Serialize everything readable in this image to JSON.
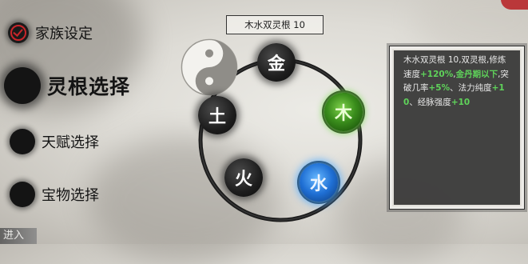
{
  "menu": {
    "items": [
      {
        "label": "家族设定",
        "state": "done"
      },
      {
        "label": "灵根选择",
        "state": "active"
      },
      {
        "label": "天赋选择",
        "state": "pending"
      },
      {
        "label": "宝物选择",
        "state": "pending"
      }
    ],
    "edge_text": "进入"
  },
  "header": {
    "title": "木水双灵根 10"
  },
  "wheel": {
    "elements": [
      {
        "label": "金",
        "selected": false
      },
      {
        "label": "木",
        "selected": true,
        "color": "#4caf2a"
      },
      {
        "label": "水",
        "selected": true,
        "color": "#2f86e8"
      },
      {
        "label": "火",
        "selected": false
      },
      {
        "label": "土",
        "selected": false
      }
    ]
  },
  "details": {
    "p1": "木水双灵根 10,双灵根,修炼速度",
    "v1": "+120%",
    "p2": ",",
    "v2": "金丹期以下",
    "p3": ",突破几率",
    "v3": "+5%",
    "p4": "、法力纯度",
    "v4": "+10",
    "p5": "、经脉强度",
    "v5": "+10"
  },
  "colors": {
    "accent_red": "#c8262a",
    "highlight_green": "#5fd35a",
    "ink": "#141414"
  }
}
